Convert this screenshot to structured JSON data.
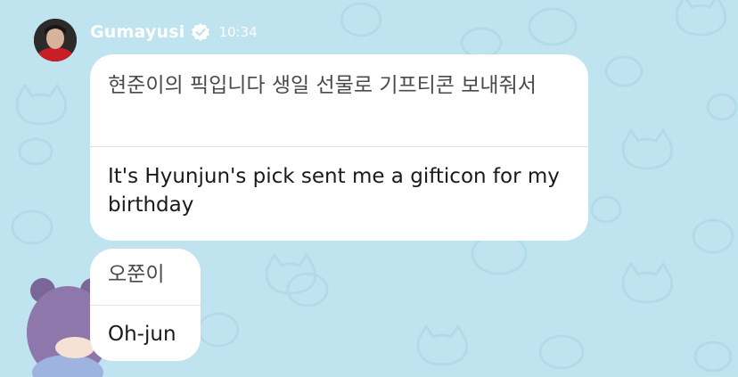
{
  "header": {
    "sender_name": "Gumayusi",
    "time": "10:34",
    "verified": true
  },
  "messages": [
    {
      "original": "현준이의 픽입니다 생일 선물로 기프티콘 보내줘서",
      "translation": "It's Hyunjun's pick sent me a gifticon for my birthday"
    },
    {
      "original": "오쭌이",
      "translation": "Oh-jun"
    }
  ],
  "theme": {
    "background": "#bfe4ef",
    "bubble": "#ffffff",
    "accent": "#ffffff"
  }
}
